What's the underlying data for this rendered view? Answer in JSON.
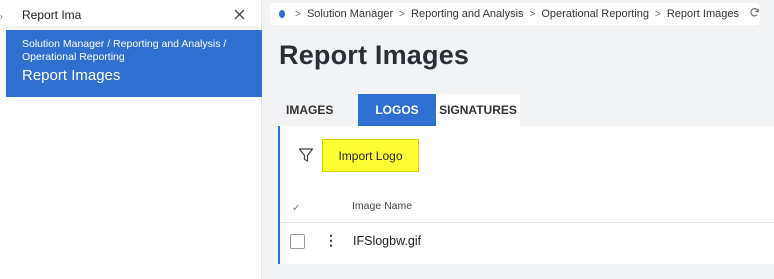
{
  "sidebar": {
    "search_value": "Report Ima",
    "clear_icon": "close-icon",
    "result_path_line1": "Solution Manager / Reporting and Analysis /",
    "result_path_line2": "Operational Reporting",
    "result_title": "Report Images"
  },
  "breadcrumb": {
    "items": [
      "Solution Manager",
      "Reporting and Analysis",
      "Operational Reporting",
      "Report Images"
    ],
    "refresh_icon": "refresh-icon"
  },
  "page": {
    "title": "Report Images"
  },
  "tabs": [
    {
      "label": "IMAGES",
      "active": false
    },
    {
      "label": "LOGOS",
      "active": true
    },
    {
      "label": "SIGNATURES",
      "active": false
    }
  ],
  "toolbar": {
    "filter_icon": "filter-icon",
    "import_label": "Import Logo"
  },
  "table": {
    "columns": [
      "Image Name"
    ],
    "rows": [
      {
        "name": "IFSlogbw.gif"
      }
    ]
  },
  "colors": {
    "accent": "#2f6fd0",
    "highlight": "#ffff33"
  }
}
